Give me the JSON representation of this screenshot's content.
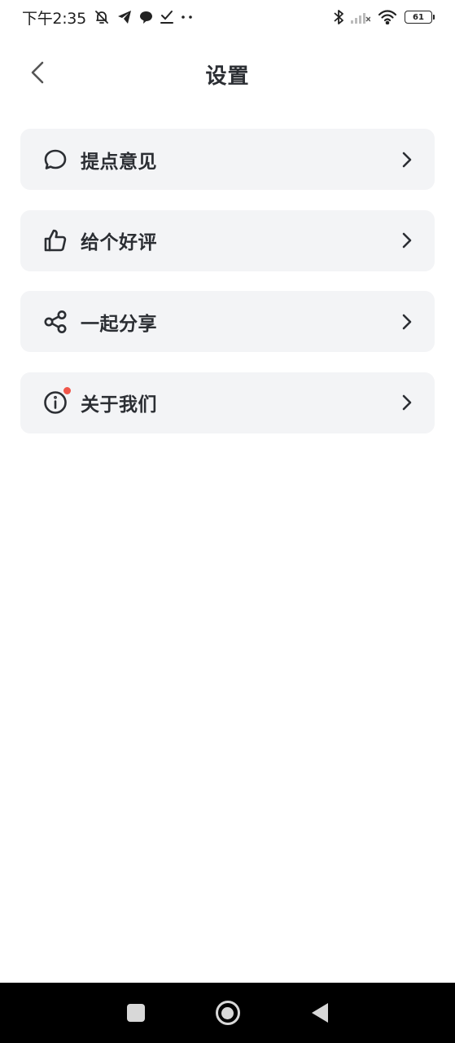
{
  "status_bar": {
    "time": "下午2:35",
    "battery": "61",
    "left_icons": [
      "muted-bell-icon",
      "telegram-icon",
      "chat-bubble-icon",
      "download-check-icon",
      "more-dots-icon"
    ],
    "right_icons": [
      "bluetooth-icon",
      "signal-icon",
      "wifi-icon",
      "battery-icon"
    ]
  },
  "header": {
    "title": "设置",
    "back_icon": "chevron-left-icon"
  },
  "menu": {
    "items": [
      {
        "label": "提点意见",
        "icon": "chat-bubble-icon"
      },
      {
        "label": "给个好评",
        "icon": "thumbs-up-icon"
      },
      {
        "label": "一起分享",
        "icon": "share-icon"
      },
      {
        "label": "关于我们",
        "icon": "info-icon",
        "badge": "red-dot"
      }
    ]
  },
  "colors": {
    "background": "#ffffff",
    "card": "#f3f4f6",
    "text": "#2b2e33",
    "badge": "#f0564a",
    "nav_bar": "#000000"
  }
}
